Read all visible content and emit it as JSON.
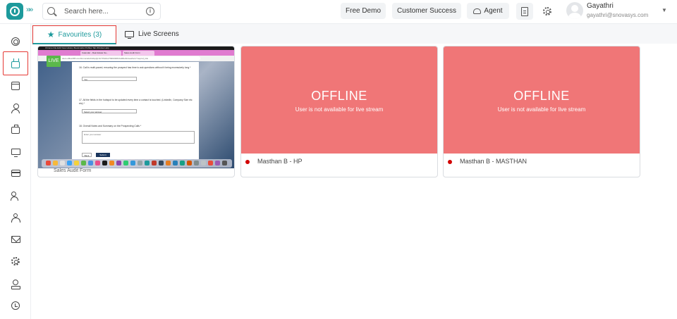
{
  "header": {
    "search_placeholder": "Search here...",
    "buttons": {
      "free_demo": "Free Demo",
      "customer_success": "Customer Success",
      "agent": "Agent"
    },
    "user": {
      "name": "Gayathri",
      "email": "gayathri@snovasys.com"
    }
  },
  "sidebar": {
    "items": [
      {
        "icon": "target-icon"
      },
      {
        "icon": "tv-icon",
        "active": true
      },
      {
        "icon": "calendar-icon"
      },
      {
        "icon": "user-icon"
      },
      {
        "icon": "briefcase-icon"
      },
      {
        "icon": "monitor-icon"
      },
      {
        "icon": "credit-card-icon"
      },
      {
        "icon": "users-icon"
      },
      {
        "icon": "team-icon"
      },
      {
        "icon": "mail-icon"
      },
      {
        "icon": "settings-icon"
      },
      {
        "icon": "badge-icon"
      },
      {
        "icon": "alarm-clock-icon"
      }
    ]
  },
  "tabs": {
    "favourites": "Favourites (3)",
    "live_screens": "Live Screens"
  },
  "cards": [
    {
      "live_badge": "LIVE",
      "caption": "Sales Audit Form",
      "screen": {
        "menubar": "Chrome  File  Edit  View  History  Bookmarks  Profiles  Tab  Window  Help",
        "tab1": "Calendar - Real Estate Sa...",
        "tab2": "Sales Audit Form",
        "url": "docs.office365.com/forms/d/e/1FAIpQLScYf6H9-kTMDOD8Cfo2RHAI/viewform?usp=sf_link",
        "q1": "16. Call is multi-paced, ensuring the prospect has time to ask questions without it being excessively long *",
        "a1": "Yes",
        "q2": "17. All the fields in the hubspot to be updated every time a contact is touched. (LinkedIn, Company Size etc etc) *",
        "a2": "Select your answer",
        "q3": "18. Overall Notes and Summary on the Prospecting Calls *",
        "a3": "Enter your answer",
        "back": "Back",
        "submit": "Submit"
      }
    },
    {
      "status": "OFFLINE",
      "message": "User is not available for live stream",
      "name": "Masthan B - HP",
      "status_color": "#d20000"
    },
    {
      "status": "OFFLINE",
      "message": "User is not available for live stream",
      "name": "Masthan B - MASTHAN",
      "status_color": "#d20000"
    }
  ],
  "colors": {
    "accent": "#1d9a9c",
    "offline_bg": "#f07677",
    "highlight": "#e53935"
  }
}
